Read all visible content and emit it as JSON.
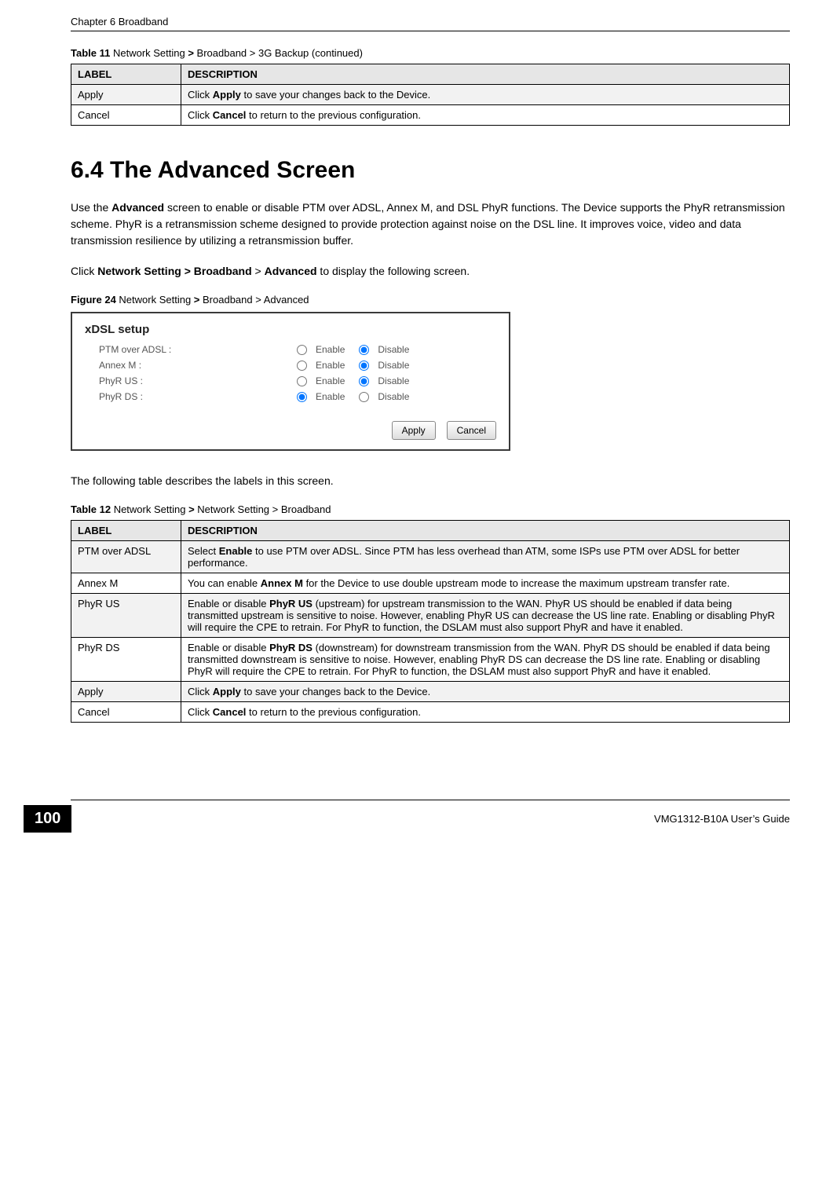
{
  "header": {
    "left": "Chapter 6 Broadband"
  },
  "table11": {
    "caption_pre": "Table 11   ",
    "caption": "Network Setting > Broadband > 3G Backup (continued)",
    "caption_bold_part": ">",
    "cols": [
      "LABEL",
      "DESCRIPTION"
    ],
    "rows": [
      {
        "label": "Apply",
        "desc_pre": "Click ",
        "desc_bold": "Apply",
        "desc_post": " to save your changes back to the Device."
      },
      {
        "label": "Cancel",
        "desc_pre": "Click ",
        "desc_bold": "Cancel",
        "desc_post": " to return to the previous configuration."
      }
    ]
  },
  "section": {
    "heading": "6.4  The Advanced Screen",
    "para1_pre": "Use the ",
    "para1_bold": "Advanced",
    "para1_post": " screen to enable or disable PTM over ADSL, Annex M, and DSL PhyR functions. The Device supports the PhyR retransmission scheme. PhyR is a retransmission scheme designed to provide protection against noise on the DSL line. It improves voice, video and data transmission resilience by utilizing a retransmission buffer.",
    "para2_pre": "Click ",
    "para2_bold1": "Network Setting > Broadband",
    "para2_mid": " > ",
    "para2_bold2": "Advanced",
    "para2_post": " to display the following screen.",
    "figcap_pre": "Figure 24   ",
    "figcap": "Network Setting > Broadband > Advanced",
    "figcap_bold_part": ">",
    "para3": "The following table describes the labels in this screen."
  },
  "figure": {
    "title": "xDSL setup",
    "rows": [
      {
        "label": "PTM over ADSL :",
        "enable": "Enable",
        "disable": "Disable",
        "selected": "disable"
      },
      {
        "label": "Annex M :",
        "enable": "Enable",
        "disable": "Disable",
        "selected": "disable"
      },
      {
        "label": "PhyR US :",
        "enable": "Enable",
        "disable": "Disable",
        "selected": "disable"
      },
      {
        "label": "PhyR DS :",
        "enable": "Enable",
        "disable": "Disable",
        "selected": "enable"
      }
    ],
    "apply": "Apply",
    "cancel": "Cancel"
  },
  "table12": {
    "caption_pre": "Table 12   ",
    "caption": "Network Setting > Network Setting > Broadband",
    "caption_bold_part": ">",
    "cols": [
      "LABEL",
      "DESCRIPTION"
    ],
    "rows": [
      {
        "label": "PTM over ADSL",
        "desc_pre": "Select ",
        "desc_bold": "Enable",
        "desc_post": " to use PTM over ADSL. Since PTM has less overhead than ATM, some ISPs use PTM over ADSL for better performance."
      },
      {
        "label": "Annex M",
        "desc_pre": "You can enable ",
        "desc_bold": "Annex M",
        "desc_post": " for the Device to use double upstream mode to increase the maximum upstream transfer rate."
      },
      {
        "label": "PhyR US",
        "desc_pre": "Enable or disable ",
        "desc_bold": "PhyR US",
        "desc_post": " (upstream) for upstream transmission to the WAN. PhyR US should be enabled if data being transmitted upstream is sensitive to noise. However, enabling PhyR US can decrease the US line rate. Enabling or disabling PhyR will require the CPE to retrain. For PhyR to function, the DSLAM must also support PhyR and have it enabled."
      },
      {
        "label": "PhyR DS",
        "desc_pre": "Enable or disable ",
        "desc_bold": "PhyR DS",
        "desc_post": " (downstream) for downstream transmission from the WAN. PhyR DS should be enabled if data being transmitted downstream is sensitive to noise. However, enabling PhyR DS can decrease the DS line rate. Enabling or disabling PhyR will require the CPE to retrain. For PhyR to function, the DSLAM must also support PhyR and have it enabled."
      },
      {
        "label": "Apply",
        "desc_pre": "Click ",
        "desc_bold": "Apply",
        "desc_post": " to save your changes back to the Device."
      },
      {
        "label": "Cancel",
        "desc_pre": "Click ",
        "desc_bold": "Cancel",
        "desc_post": " to return to the previous configuration."
      }
    ]
  },
  "footer": {
    "page": "100",
    "guide": "VMG1312-B10A User’s Guide"
  }
}
